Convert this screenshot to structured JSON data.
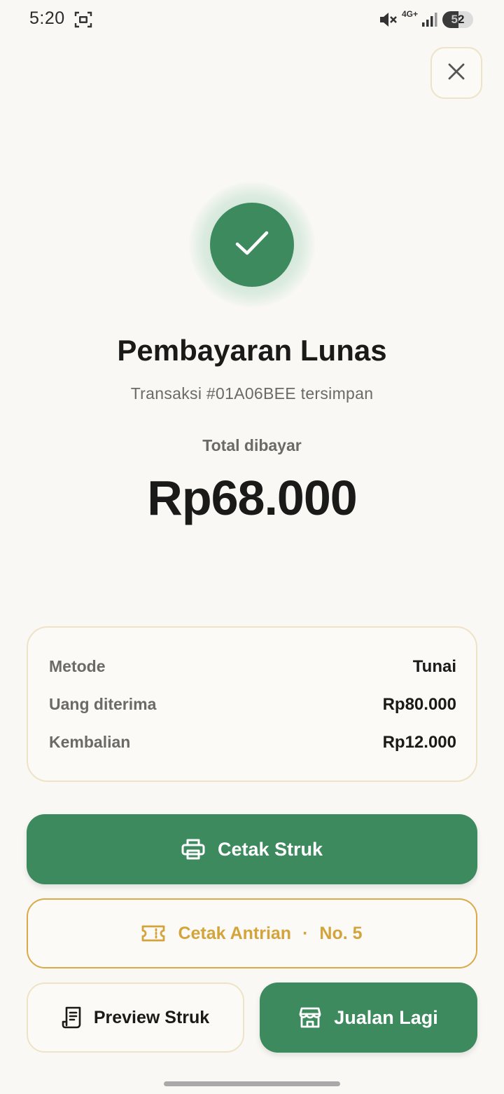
{
  "status_bar": {
    "time": "5:20",
    "network": "4G+",
    "battery_level": "52",
    "icons": [
      "screenshot-icon",
      "mute-icon",
      "signal-icon",
      "battery-icon"
    ]
  },
  "header": {
    "close_icon": "close-icon"
  },
  "success": {
    "icon": "check-icon",
    "title": "Pembayaran Lunas",
    "subtitle": "Transaksi #01A06BEE tersimpan",
    "total_label": "Total dibayar",
    "total_amount": "Rp68.000"
  },
  "details": [
    {
      "label": "Metode",
      "value": "Tunai"
    },
    {
      "label": "Uang diterima",
      "value": "Rp80.000"
    },
    {
      "label": "Kembalian",
      "value": "Rp12.000"
    }
  ],
  "actions": {
    "print_receipt": {
      "label": "Cetak Struk",
      "icon": "printer-icon"
    },
    "print_queue": {
      "label": "Cetak Antrian",
      "separator": "·",
      "number": "No. 5",
      "icon": "ticket-icon"
    },
    "preview_receipt": {
      "label": "Preview Struk",
      "icon": "receipt-icon"
    },
    "sell_again": {
      "label": "Jualan Lagi",
      "icon": "store-icon"
    }
  },
  "colors": {
    "primary_green": "#3d8a5f",
    "accent_gold": "#d4a43c",
    "background": "#f9f8f4",
    "border": "#eee3c6"
  }
}
